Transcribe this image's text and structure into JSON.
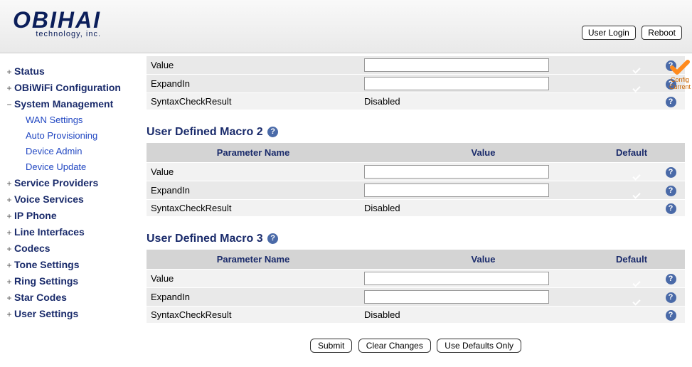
{
  "header": {
    "logo_top": "OBIHAI",
    "logo_sub": "technology, inc.",
    "buttons": {
      "login": "User Login",
      "reboot": "Reboot"
    }
  },
  "sidebar": {
    "items": [
      {
        "marker": "+",
        "label": "Status",
        "expanded": false,
        "sub": []
      },
      {
        "marker": "+",
        "label": "OBiWiFi Configuration",
        "expanded": false,
        "sub": []
      },
      {
        "marker": "−",
        "label": "System Management",
        "expanded": true,
        "sub": [
          "WAN Settings",
          "Auto Provisioning",
          "Device Admin",
          "Device Update"
        ]
      },
      {
        "marker": "+",
        "label": "Service Providers",
        "expanded": false,
        "sub": []
      },
      {
        "marker": "+",
        "label": "Voice Services",
        "expanded": false,
        "sub": []
      },
      {
        "marker": "+",
        "label": "IP Phone",
        "expanded": false,
        "sub": []
      },
      {
        "marker": "+",
        "label": "Line Interfaces",
        "expanded": false,
        "sub": []
      },
      {
        "marker": "+",
        "label": "Codecs",
        "expanded": false,
        "sub": []
      },
      {
        "marker": "+",
        "label": "Tone Settings",
        "expanded": false,
        "sub": []
      },
      {
        "marker": "+",
        "label": "Ring Settings",
        "expanded": false,
        "sub": []
      },
      {
        "marker": "+",
        "label": "Star Codes",
        "expanded": false,
        "sub": []
      },
      {
        "marker": "+",
        "label": "User Settings",
        "expanded": false,
        "sub": []
      }
    ]
  },
  "columns": {
    "name": "Parameter Name",
    "value": "Value",
    "def": "Default"
  },
  "sections": {
    "m1": {
      "rows": [
        {
          "param": "Value",
          "kind": "input",
          "value": "",
          "default": true
        },
        {
          "param": "ExpandIn",
          "kind": "input",
          "value": "",
          "default": true
        },
        {
          "param": "SyntaxCheckResult",
          "kind": "static",
          "value": "Disabled",
          "default": false
        }
      ]
    },
    "m2": {
      "title": "User Defined Macro 2",
      "rows": [
        {
          "param": "Value",
          "kind": "input",
          "value": "",
          "default": true
        },
        {
          "param": "ExpandIn",
          "kind": "input",
          "value": "",
          "default": true
        },
        {
          "param": "SyntaxCheckResult",
          "kind": "static",
          "value": "Disabled",
          "default": false
        }
      ]
    },
    "m3": {
      "title": "User Defined Macro 3",
      "rows": [
        {
          "param": "Value",
          "kind": "input",
          "value": "",
          "default": true
        },
        {
          "param": "ExpandIn",
          "kind": "input",
          "value": "",
          "default": true
        },
        {
          "param": "SyntaxCheckResult",
          "kind": "static",
          "value": "Disabled",
          "default": false
        }
      ]
    }
  },
  "badge": {
    "line1": "Config",
    "line2": "Current"
  },
  "footer": {
    "submit": "Submit",
    "clear": "Clear Changes",
    "defaults": "Use Defaults Only"
  }
}
